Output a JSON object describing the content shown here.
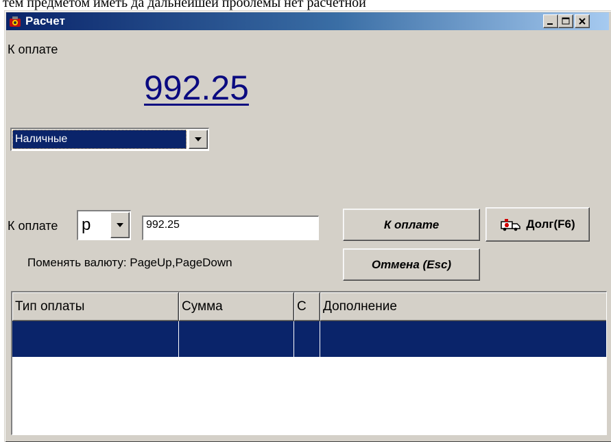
{
  "background_text": "тем  предметом  иметь  да  дальнейшей  проблемы  нет  расчетной",
  "window": {
    "title": "Расчет",
    "colors": {
      "title_bar_start": "#0a246a",
      "title_bar_end": "#a6caf0",
      "face": "#d4d0c8",
      "amount": "#0a0a80",
      "selection": "#0a246a"
    }
  },
  "header": {
    "to_pay_label": "К оплате",
    "amount": "992.25"
  },
  "payment_type": {
    "selected": "Наличные"
  },
  "payment": {
    "label": "К оплате",
    "currency": "р",
    "amount_value": "992.25",
    "hint": "Поменять валюту: PageUp,PageDown"
  },
  "buttons": {
    "pay": "К оплате",
    "debt": "Долг(F6)",
    "cancel": "Отмена (Esc)"
  },
  "grid": {
    "columns": [
      "Тип оплаты",
      "Сумма",
      "С",
      "Дополнение"
    ],
    "rows": [
      [
        "",
        "",
        "",
        ""
      ]
    ]
  }
}
